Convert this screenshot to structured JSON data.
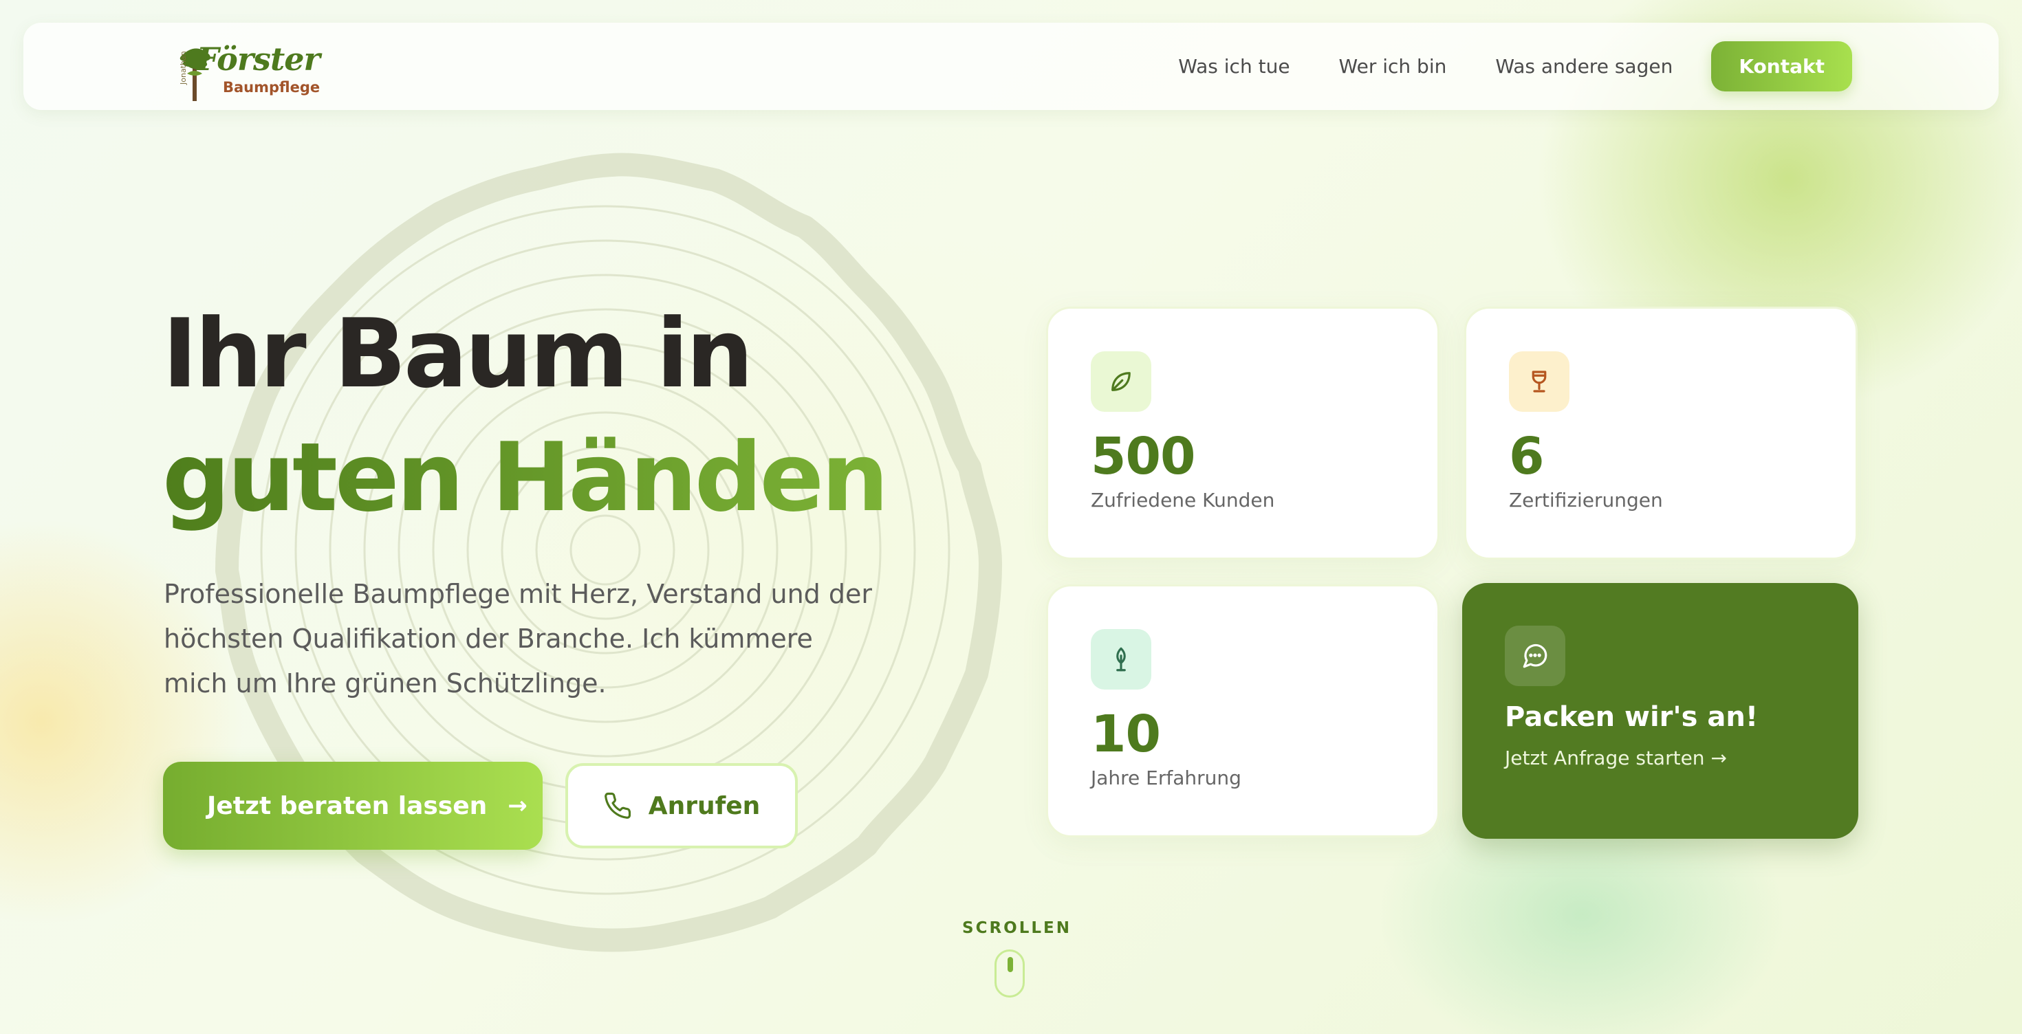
{
  "colors": {
    "brand_green": "#4e7a1e",
    "accent_lime": "#a8e04e",
    "cta_card_bg": "#527b22",
    "logo_brown": "#a2542a"
  },
  "header": {
    "logo": {
      "small_text": "Jonathan",
      "name": "Förster",
      "tagline": "Baumpflege"
    },
    "nav": [
      {
        "label": "Was ich tue"
      },
      {
        "label": "Wer ich bin"
      },
      {
        "label": "Was andere sagen"
      }
    ],
    "cta_label": "Kontakt"
  },
  "hero": {
    "title_line1": "Ihr Baum in",
    "title_line2": "guten Händen",
    "description": "Professionelle Baumpflege mit Herz, Verstand und der höchsten Qualifikation der Branche. Ich kümmere mich um Ihre grünen Schützlinge.",
    "primary_button": {
      "label": "Jetzt beraten lassen",
      "icon": "arrow-right-icon"
    },
    "secondary_button": {
      "label": "Anrufen",
      "icon": "phone-icon"
    }
  },
  "stats": [
    {
      "value": "500",
      "label": "Zufriedene Kunden",
      "icon": "leaf-icon"
    },
    {
      "value": "6",
      "label": "Zertifizierungen",
      "icon": "trophy-icon"
    },
    {
      "value": "10",
      "label": "Jahre Erfahrung",
      "icon": "tree-icon"
    }
  ],
  "cta_card": {
    "title": "Packen wir's an!",
    "link": "Jetzt Anfrage starten →",
    "icon": "chat-bubble-icon"
  },
  "scroll_hint": {
    "label": "SCROLLEN",
    "icon": "mouse-icon"
  }
}
